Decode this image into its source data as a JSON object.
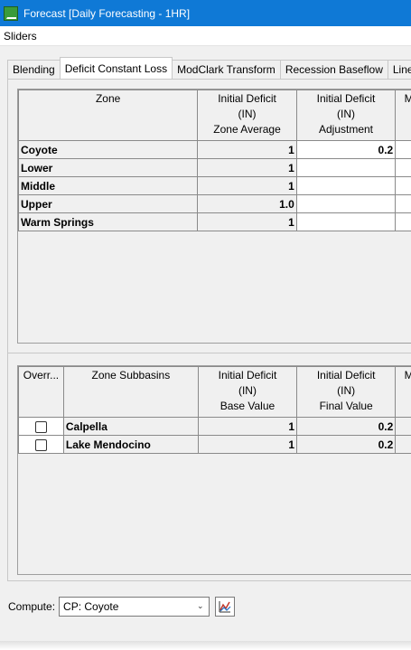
{
  "window": {
    "title": "Forecast [Daily Forecasting - 1HR]"
  },
  "menu": {
    "items": [
      "Sliders"
    ]
  },
  "tabs": [
    {
      "label": "Blending"
    },
    {
      "label": "Deficit Constant Loss",
      "active": true
    },
    {
      "label": "ModClark Transform"
    },
    {
      "label": "Recession Baseflow"
    },
    {
      "label": "Linea"
    }
  ],
  "zone_table": {
    "headers": {
      "zone": "Zone",
      "avg": [
        "Initial Deficit",
        "(IN)",
        "Zone Average"
      ],
      "adj": [
        "Initial Deficit",
        "(IN)",
        "Adjustment"
      ],
      "next": "M"
    },
    "rows": [
      {
        "zone": "Coyote",
        "avg": "1",
        "adj": "0.2"
      },
      {
        "zone": "Lower",
        "avg": "1",
        "adj": ""
      },
      {
        "zone": "Middle",
        "avg": "1",
        "adj": ""
      },
      {
        "zone": "Upper",
        "avg": "1.0",
        "adj": ""
      },
      {
        "zone": "Warm Springs",
        "avg": "1",
        "adj": ""
      }
    ]
  },
  "subbasin_table": {
    "headers": {
      "override": "Overr...",
      "subbasins": "Zone Subbasins",
      "base": [
        "Initial Deficit",
        "(IN)",
        "Base Value"
      ],
      "final": [
        "Initial Deficit",
        "(IN)",
        "Final Value"
      ],
      "next": "M"
    },
    "rows": [
      {
        "override": false,
        "name": "Calpella",
        "base": "1",
        "final": "0.2"
      },
      {
        "override": false,
        "name": "Lake Mendocino",
        "base": "1",
        "final": "0.2"
      }
    ]
  },
  "compute": {
    "label": "Compute:",
    "value": "CP: Coyote"
  },
  "colors": {
    "titlebar": "#0f79d6",
    "panel": "#f0f0f0"
  }
}
